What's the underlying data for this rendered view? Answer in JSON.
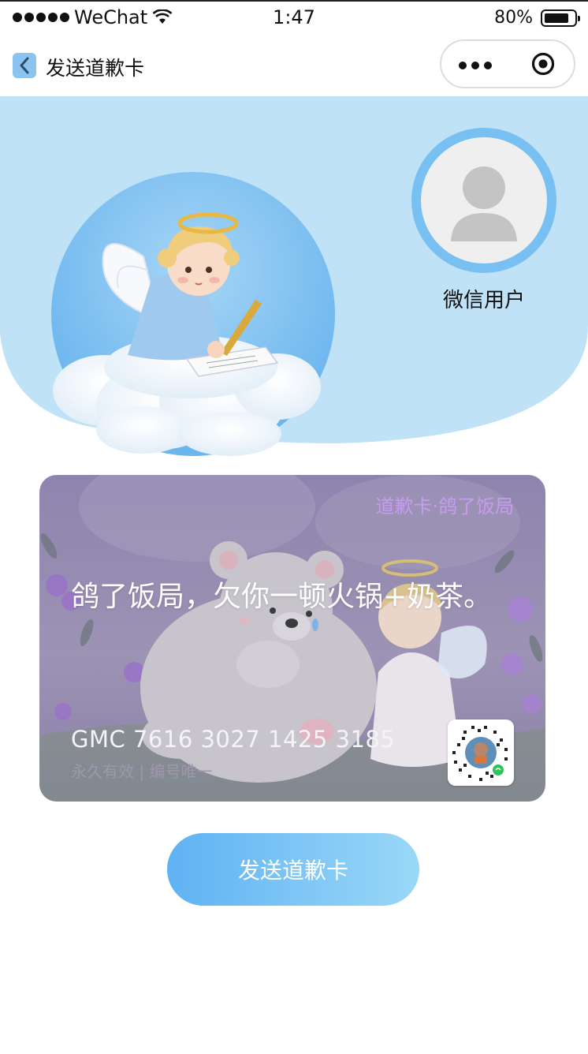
{
  "status_bar": {
    "carrier": "WeChat",
    "time": "1:47",
    "battery": "80%",
    "battery_level": 0.8
  },
  "nav": {
    "title": "发送道歉卡",
    "back_icon": "chevron-left-icon",
    "more_icon": "more-dots-icon",
    "close_icon": "target-icon"
  },
  "profile": {
    "username": "微信用户",
    "avatar_icon": "default-user-icon"
  },
  "card": {
    "tag": "道歉卡·鸽了饭局",
    "message": "鸽了饭局，欠你一顿火锅+奶茶。",
    "number": "GMC 7616 3027 1425 3185",
    "validity": "永久有效 | 编号唯一"
  },
  "send_button": {
    "label": "发送道歉卡"
  },
  "colors": {
    "hero_bg": "#bfe2f7",
    "avatar_ring": "#79c0f2",
    "button_start": "#5fb2f3",
    "button_end": "#9ad8f7",
    "card_tag": "#c79cf0"
  }
}
